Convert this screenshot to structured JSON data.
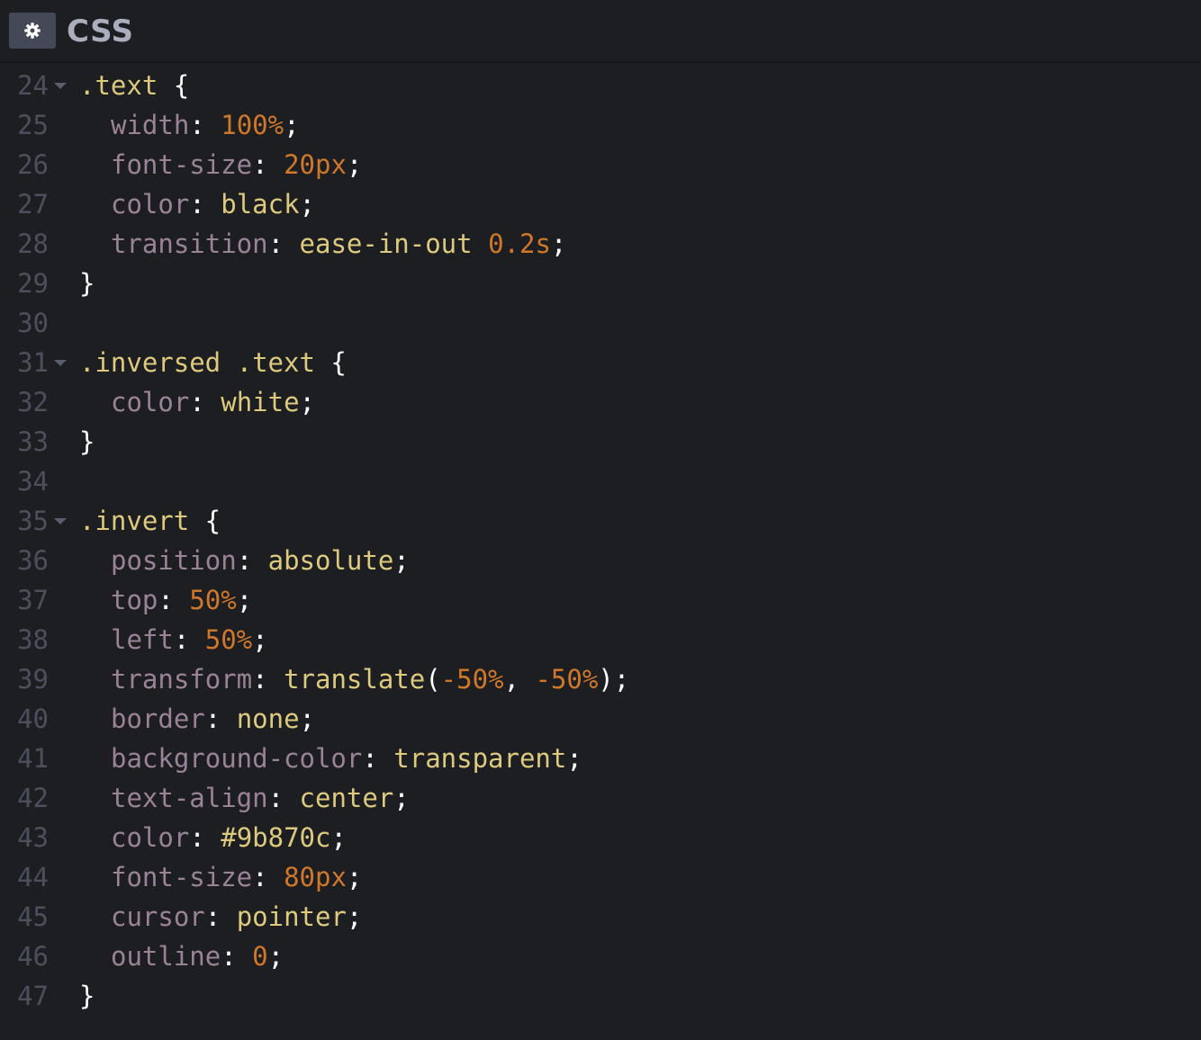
{
  "header": {
    "title": "CSS",
    "settings_icon": "gear-icon"
  },
  "colors": {
    "background": "#1d1e22",
    "selector": "#ddca7e",
    "property": "#9a8297",
    "number": "#d0782a",
    "punctuation": "#ffffff",
    "line_number": "#4c4f5c"
  },
  "lines": [
    {
      "n": "24",
      "fold": true,
      "segs": [
        {
          "t": ".text",
          "c": "sel"
        },
        {
          "t": " {",
          "c": "punc"
        }
      ]
    },
    {
      "n": "25",
      "indent": true,
      "segs": [
        {
          "t": "width",
          "c": "prop"
        },
        {
          "t": ": ",
          "c": "punc"
        },
        {
          "t": "100%",
          "c": "num"
        },
        {
          "t": ";",
          "c": "punc"
        }
      ]
    },
    {
      "n": "26",
      "indent": true,
      "segs": [
        {
          "t": "font-size",
          "c": "prop"
        },
        {
          "t": ": ",
          "c": "punc"
        },
        {
          "t": "20px",
          "c": "num"
        },
        {
          "t": ";",
          "c": "punc"
        }
      ]
    },
    {
      "n": "27",
      "indent": true,
      "segs": [
        {
          "t": "color",
          "c": "prop"
        },
        {
          "t": ": ",
          "c": "punc"
        },
        {
          "t": "black",
          "c": "val"
        },
        {
          "t": ";",
          "c": "punc"
        }
      ]
    },
    {
      "n": "28",
      "indent": true,
      "segs": [
        {
          "t": "transition",
          "c": "prop"
        },
        {
          "t": ": ",
          "c": "punc"
        },
        {
          "t": "ease-in-out",
          "c": "val"
        },
        {
          "t": " ",
          "c": "punc"
        },
        {
          "t": "0.2s",
          "c": "num"
        },
        {
          "t": ";",
          "c": "punc"
        }
      ]
    },
    {
      "n": "29",
      "segs": [
        {
          "t": "}",
          "c": "punc"
        }
      ]
    },
    {
      "n": "30",
      "segs": []
    },
    {
      "n": "31",
      "fold": true,
      "segs": [
        {
          "t": ".inversed",
          "c": "sel"
        },
        {
          "t": " ",
          "c": "punc"
        },
        {
          "t": ".text",
          "c": "sel"
        },
        {
          "t": " {",
          "c": "punc"
        }
      ]
    },
    {
      "n": "32",
      "indent": true,
      "segs": [
        {
          "t": "color",
          "c": "prop"
        },
        {
          "t": ": ",
          "c": "punc"
        },
        {
          "t": "white",
          "c": "val"
        },
        {
          "t": ";",
          "c": "punc"
        }
      ]
    },
    {
      "n": "33",
      "segs": [
        {
          "t": "}",
          "c": "punc"
        }
      ]
    },
    {
      "n": "34",
      "segs": []
    },
    {
      "n": "35",
      "fold": true,
      "segs": [
        {
          "t": ".invert",
          "c": "sel"
        },
        {
          "t": " {",
          "c": "punc"
        }
      ]
    },
    {
      "n": "36",
      "indent": true,
      "segs": [
        {
          "t": "position",
          "c": "prop"
        },
        {
          "t": ": ",
          "c": "punc"
        },
        {
          "t": "absolute",
          "c": "val"
        },
        {
          "t": ";",
          "c": "punc"
        }
      ]
    },
    {
      "n": "37",
      "indent": true,
      "segs": [
        {
          "t": "top",
          "c": "prop"
        },
        {
          "t": ": ",
          "c": "punc"
        },
        {
          "t": "50%",
          "c": "num"
        },
        {
          "t": ";",
          "c": "punc"
        }
      ]
    },
    {
      "n": "38",
      "indent": true,
      "segs": [
        {
          "t": "left",
          "c": "prop"
        },
        {
          "t": ": ",
          "c": "punc"
        },
        {
          "t": "50%",
          "c": "num"
        },
        {
          "t": ";",
          "c": "punc"
        }
      ]
    },
    {
      "n": "39",
      "indent": true,
      "segs": [
        {
          "t": "transform",
          "c": "prop"
        },
        {
          "t": ": ",
          "c": "punc"
        },
        {
          "t": "translate",
          "c": "val"
        },
        {
          "t": "(",
          "c": "punc"
        },
        {
          "t": "-50%",
          "c": "num"
        },
        {
          "t": ", ",
          "c": "punc"
        },
        {
          "t": "-50%",
          "c": "num"
        },
        {
          "t": ");",
          "c": "punc"
        }
      ]
    },
    {
      "n": "40",
      "indent": true,
      "segs": [
        {
          "t": "border",
          "c": "prop"
        },
        {
          "t": ": ",
          "c": "punc"
        },
        {
          "t": "none",
          "c": "val"
        },
        {
          "t": ";",
          "c": "punc"
        }
      ]
    },
    {
      "n": "41",
      "indent": true,
      "segs": [
        {
          "t": "background-color",
          "c": "prop"
        },
        {
          "t": ": ",
          "c": "punc"
        },
        {
          "t": "transparent",
          "c": "val"
        },
        {
          "t": ";",
          "c": "punc"
        }
      ]
    },
    {
      "n": "42",
      "indent": true,
      "segs": [
        {
          "t": "text-align",
          "c": "prop"
        },
        {
          "t": ": ",
          "c": "punc"
        },
        {
          "t": "center",
          "c": "val"
        },
        {
          "t": ";",
          "c": "punc"
        }
      ]
    },
    {
      "n": "43",
      "indent": true,
      "segs": [
        {
          "t": "color",
          "c": "prop"
        },
        {
          "t": ": ",
          "c": "punc"
        },
        {
          "t": "#9b870c",
          "c": "val"
        },
        {
          "t": ";",
          "c": "punc"
        }
      ]
    },
    {
      "n": "44",
      "indent": true,
      "segs": [
        {
          "t": "font-size",
          "c": "prop"
        },
        {
          "t": ": ",
          "c": "punc"
        },
        {
          "t": "80px",
          "c": "num"
        },
        {
          "t": ";",
          "c": "punc"
        }
      ]
    },
    {
      "n": "45",
      "indent": true,
      "segs": [
        {
          "t": "cursor",
          "c": "prop"
        },
        {
          "t": ": ",
          "c": "punc"
        },
        {
          "t": "pointer",
          "c": "val"
        },
        {
          "t": ";",
          "c": "punc"
        }
      ]
    },
    {
      "n": "46",
      "indent": true,
      "segs": [
        {
          "t": "outline",
          "c": "prop"
        },
        {
          "t": ": ",
          "c": "punc"
        },
        {
          "t": "0",
          "c": "num"
        },
        {
          "t": ";",
          "c": "punc"
        }
      ]
    },
    {
      "n": "47",
      "segs": [
        {
          "t": "}",
          "c": "punc"
        }
      ]
    }
  ]
}
